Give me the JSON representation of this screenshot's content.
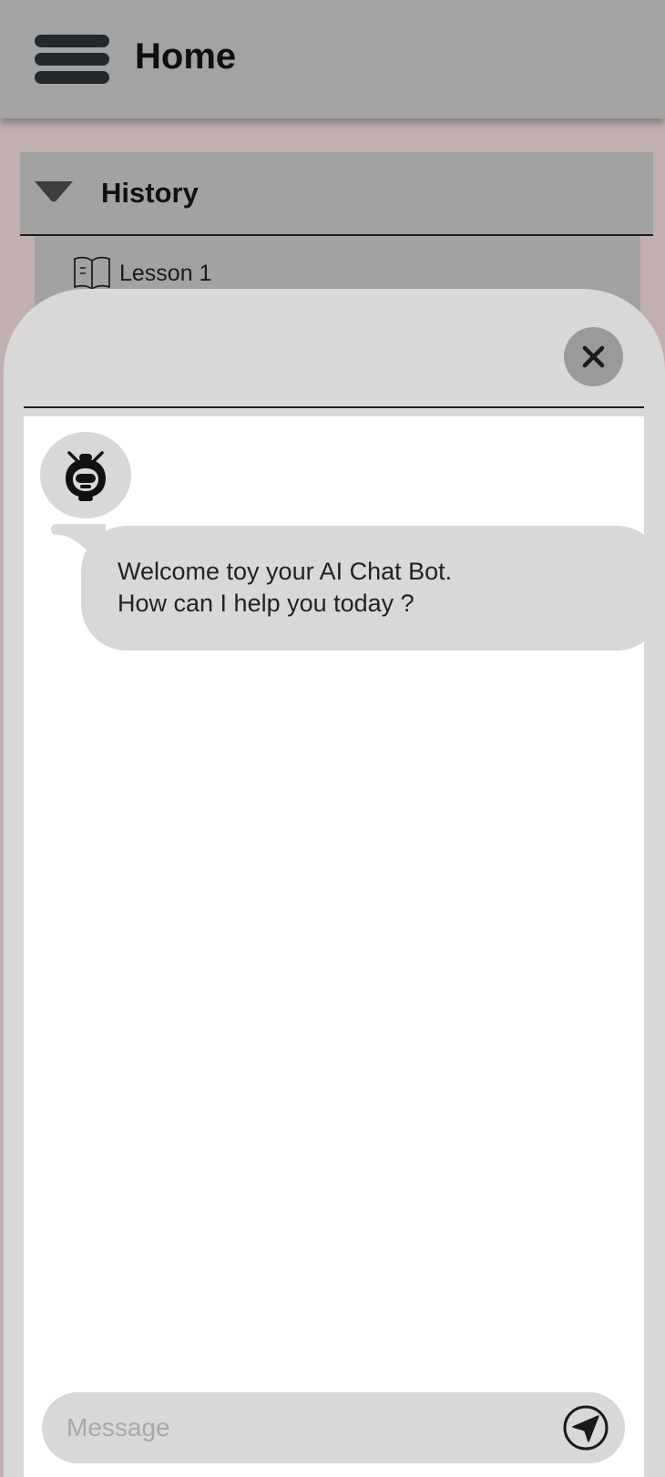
{
  "header": {
    "title": "Home",
    "menu_icon": "hamburger-icon"
  },
  "history": {
    "label": "History",
    "expanded": true,
    "toggle_icon": "caret-down-icon",
    "items": [
      {
        "label": "Lesson 1",
        "icon": "book-icon"
      }
    ]
  },
  "chat": {
    "close_icon": "close-icon",
    "bot_avatar_icon": "robot-icon",
    "messages": [
      {
        "sender": "bot",
        "text": "Welcome toy your AI Chat Bot.\nHow can I help you today ?"
      }
    ],
    "composer": {
      "placeholder": "Message",
      "value": "",
      "send_icon": "send-icon"
    }
  },
  "colors": {
    "page_background": "#c2b0b1",
    "header_background": "#a3a3a3",
    "sheet_background": "#d8d8d8",
    "chat_background": "#ffffff",
    "text_dark": "#111111",
    "placeholder": "#a9a9a9"
  }
}
